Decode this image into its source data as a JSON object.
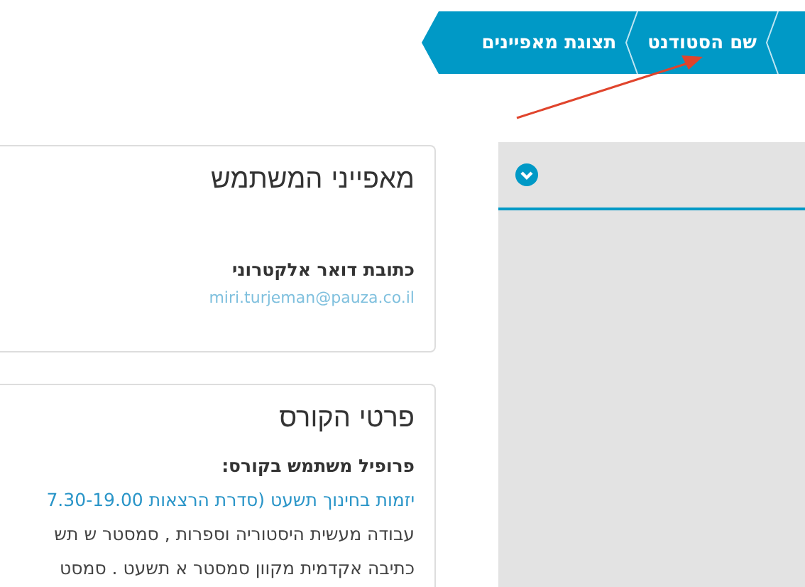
{
  "breadcrumbs": [
    {
      "label": "שם הסטודנט"
    },
    {
      "label": "תצוגת מאפיינים"
    }
  ],
  "user_card": {
    "title": "מאפייני המשתמש",
    "fields": [
      {
        "label": "כתובת דואר אלקטרוני",
        "value": "miri.turjeman@pauza.co.il"
      }
    ]
  },
  "course_card": {
    "title": "פרטי הקורס",
    "profile_label": "פרופיל משתמש בקורס:",
    "courses": [
      {
        "text": "יזמות בחינוך תשעט (סדרת הרצאות 7.30-19.00",
        "link": true
      },
      {
        "text": "עבודה מעשית היסטוריה וספרות , סמסטר ש תש",
        "link": false
      },
      {
        "text": "כתיבה אקדמית מקוון סמסטר א תשעט . סמסט",
        "link": false
      }
    ]
  }
}
